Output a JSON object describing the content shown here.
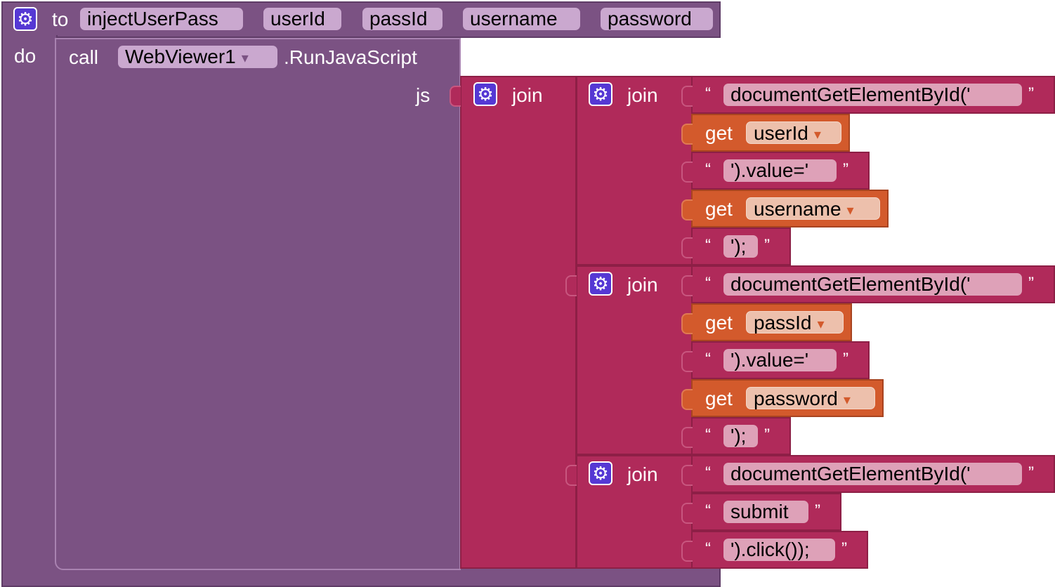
{
  "procedure": {
    "to_label": "to",
    "name": "injectUserPass",
    "params": [
      "userId",
      "passId",
      "username",
      "password"
    ],
    "do_label": "do",
    "gear_icon": "gear-icon"
  },
  "call": {
    "call_label": "call",
    "component": "WebViewer1",
    "dropdown_icon": "▾",
    "method": ".RunJavaScript",
    "arg_label": "js"
  },
  "join_outer": {
    "label": "join"
  },
  "join1": {
    "label": "join",
    "items": [
      {
        "type": "text",
        "value": "documentGetElementById('"
      },
      {
        "type": "get",
        "label": "get",
        "var": "userId"
      },
      {
        "type": "text",
        "value": "').value='"
      },
      {
        "type": "get",
        "label": "get",
        "var": "username"
      },
      {
        "type": "text",
        "value": "');"
      }
    ]
  },
  "join2": {
    "label": "join",
    "items": [
      {
        "type": "text",
        "value": "documentGetElementById('"
      },
      {
        "type": "get",
        "label": "get",
        "var": "passId"
      },
      {
        "type": "text",
        "value": "').value='"
      },
      {
        "type": "get",
        "label": "get",
        "var": "password"
      },
      {
        "type": "text",
        "value": "');"
      }
    ]
  },
  "join3": {
    "label": "join",
    "items": [
      {
        "type": "text",
        "value": "documentGetElementById('"
      },
      {
        "type": "text",
        "value": "submit"
      },
      {
        "type": "text",
        "value": "').click());"
      }
    ]
  },
  "quotes": {
    "open": "“",
    "close": "”"
  },
  "colors": {
    "procedure": "#7b5283",
    "text_join": "#b02a5a",
    "variable_get": "#d35a2c",
    "mutator": "#5538d4"
  }
}
